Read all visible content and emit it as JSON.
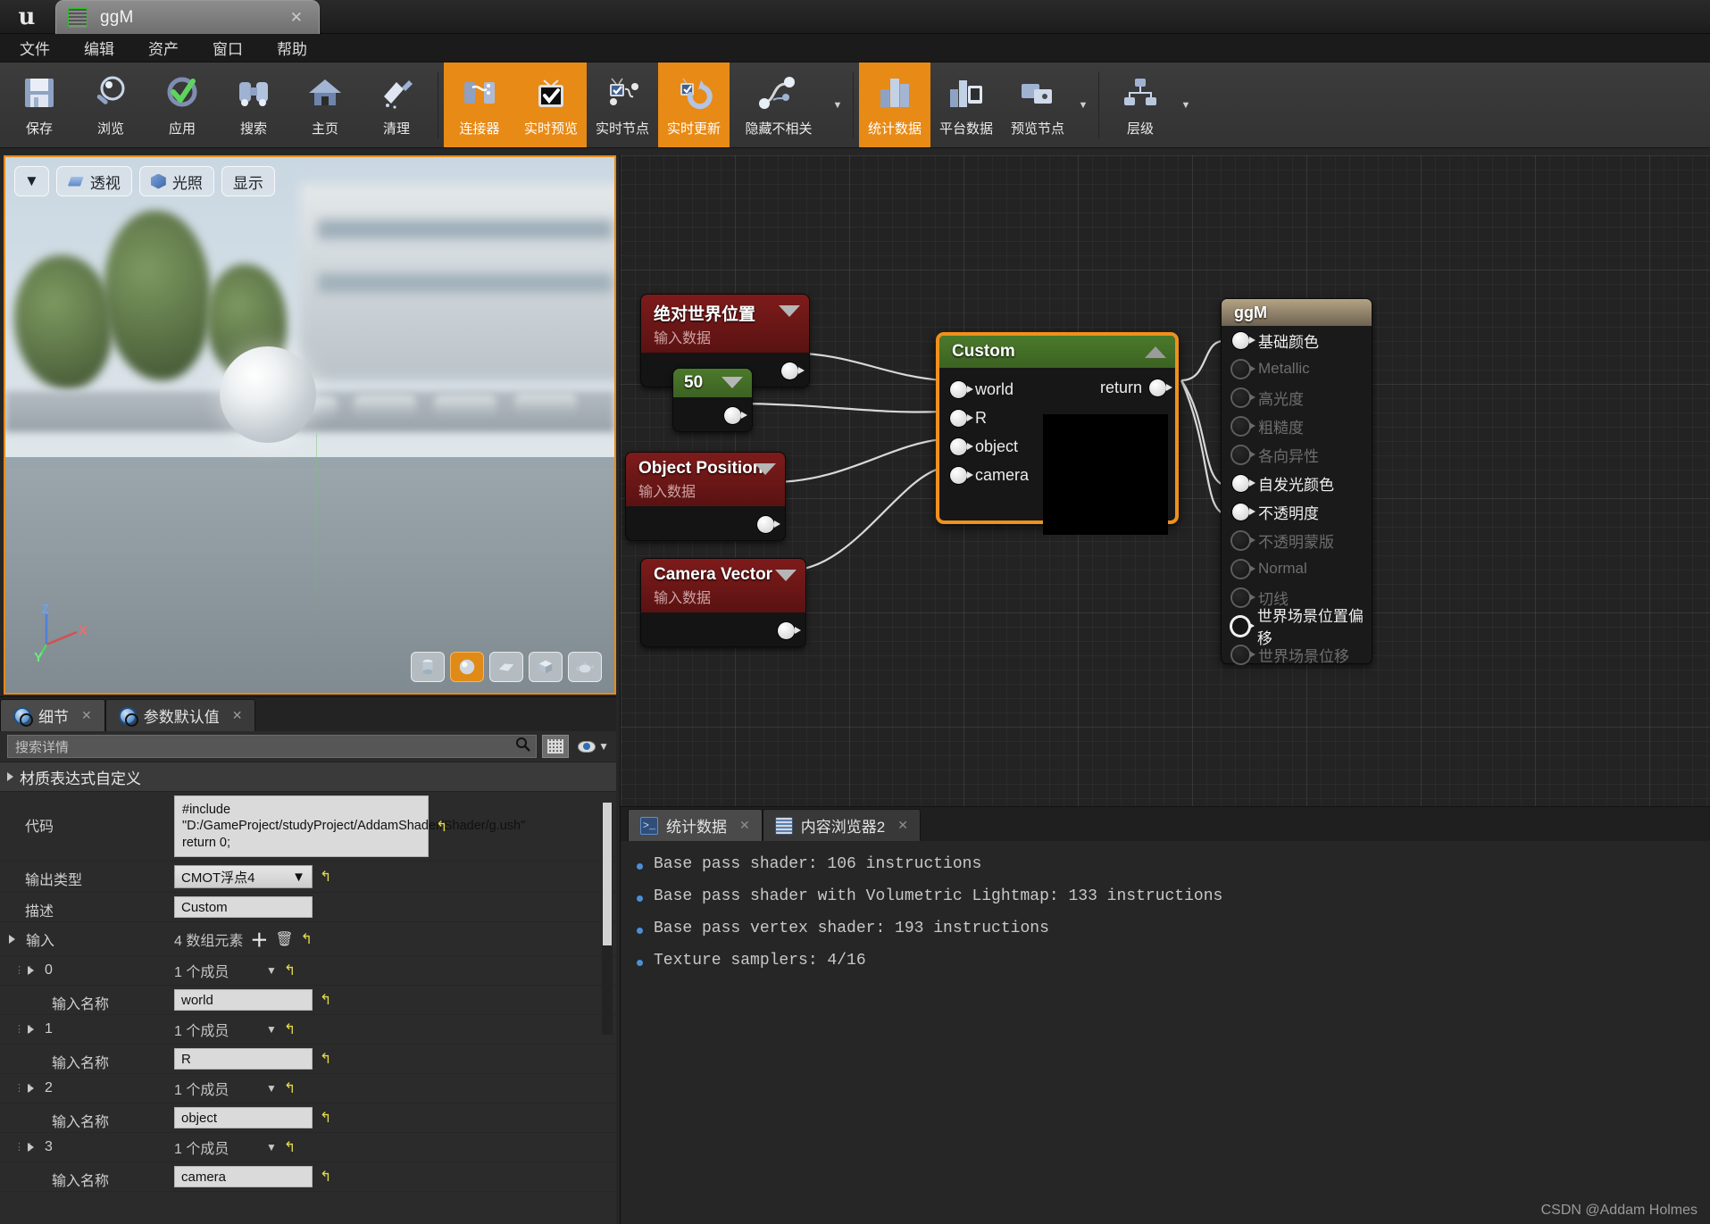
{
  "titlebar": {
    "asset_tab_label": "ggM",
    "close_glyph": "✕"
  },
  "menubar": {
    "items": [
      "文件",
      "编辑",
      "资产",
      "窗口",
      "帮助"
    ]
  },
  "toolbar": {
    "items": [
      {
        "label": "保存",
        "icon": "save-icon",
        "active": false
      },
      {
        "label": "浏览",
        "icon": "browse-icon",
        "active": false
      },
      {
        "label": "应用",
        "icon": "apply-check-icon",
        "active": false
      },
      {
        "label": "搜索",
        "icon": "search-binoculars-icon",
        "active": false
      },
      {
        "label": "主页",
        "icon": "home-icon",
        "active": false
      },
      {
        "label": "清理",
        "icon": "clean-icon",
        "active": false
      },
      {
        "label": "连接器",
        "icon": "connectors-icon",
        "active": true
      },
      {
        "label": "实时预览",
        "icon": "live-preview-icon",
        "active": true
      },
      {
        "label": "实时节点",
        "icon": "live-nodes-icon",
        "active": false
      },
      {
        "label": "实时更新",
        "icon": "live-update-icon",
        "active": true
      },
      {
        "label": "隐藏不相关",
        "icon": "hide-unrelated-icon",
        "active": false
      },
      {
        "label": "统计数据",
        "icon": "stats-bars-icon",
        "active": true
      },
      {
        "label": "平台数据",
        "icon": "platform-stats-icon",
        "active": false
      },
      {
        "label": "预览节点",
        "icon": "preview-node-icon",
        "active": false
      },
      {
        "label": "层级",
        "icon": "hierarchy-icon",
        "active": false
      }
    ]
  },
  "viewport": {
    "dropdown_glyph": "▼",
    "perspective_label": "透视",
    "lighting_label": "光照",
    "show_label": "显示",
    "axis": {
      "x": "X",
      "y": "Y",
      "z": "Z"
    },
    "shapes": [
      {
        "name": "cylinder-preview",
        "selected": false
      },
      {
        "name": "sphere-preview",
        "selected": true
      },
      {
        "name": "plane-preview",
        "selected": false
      },
      {
        "name": "cube-preview",
        "selected": false
      },
      {
        "name": "teapot-preview",
        "selected": false
      }
    ]
  },
  "details": {
    "tabs": [
      {
        "label": "细节",
        "selected": true,
        "close": "✕"
      },
      {
        "label": "参数默认值",
        "selected": false,
        "close": "✕"
      }
    ],
    "search_placeholder": "搜索详情",
    "search_value": "",
    "category": "材质表达式自定义",
    "rows": [
      {
        "name": "代码",
        "type": "code",
        "value": "#include \"D:/GameProject/studyProject/AddamShader/Shader/g.ush\"\nreturn 0;"
      },
      {
        "name": "输出类型",
        "type": "select",
        "value": "CMOT浮点4"
      },
      {
        "name": "描述",
        "type": "text",
        "value": "Custom"
      },
      {
        "name": "输入",
        "type": "array_header",
        "value": "4 数组元素"
      },
      {
        "name": "0",
        "type": "index",
        "value": "1 个成员"
      },
      {
        "name": "输入名称",
        "type": "text",
        "value": "world"
      },
      {
        "name": "1",
        "type": "index",
        "value": "1 个成员"
      },
      {
        "name": "输入名称",
        "type": "text",
        "value": "R"
      },
      {
        "name": "2",
        "type": "index",
        "value": "1 个成员"
      },
      {
        "name": "输入名称",
        "type": "text",
        "value": "object"
      },
      {
        "name": "3",
        "type": "index",
        "value": "1 个成员"
      },
      {
        "name": "输入名称",
        "type": "text",
        "value": "camera"
      }
    ]
  },
  "graph": {
    "nodes": [
      {
        "id": "abs-world-pos",
        "title": "绝对世界位置",
        "subtitle": "输入数据",
        "header": "red",
        "caret": "down"
      },
      {
        "id": "const-50",
        "title": "50",
        "subtitle": "",
        "header": "green",
        "caret": "down"
      },
      {
        "id": "object-position",
        "title": "Object Position",
        "subtitle": "输入数据",
        "header": "red",
        "caret": "down"
      },
      {
        "id": "camera-vector",
        "title": "Camera Vector",
        "subtitle": "输入数据",
        "header": "red",
        "caret": "down"
      }
    ],
    "custom_node": {
      "title": "Custom",
      "caret": "up",
      "inputs": [
        "world",
        "R",
        "object",
        "camera"
      ],
      "output": "return",
      "selected": true,
      "accent": "#f0901d"
    },
    "output_node": {
      "title": "ggM",
      "pins": [
        {
          "label": "基础颜色",
          "connected": true
        },
        {
          "label": "Metallic",
          "connected": false
        },
        {
          "label": "高光度",
          "connected": false
        },
        {
          "label": "粗糙度",
          "connected": false
        },
        {
          "label": "各向异性",
          "connected": false
        },
        {
          "label": "自发光颜色",
          "connected": true
        },
        {
          "label": "不透明度",
          "connected": true
        },
        {
          "label": "不透明蒙版",
          "connected": false
        },
        {
          "label": "Normal",
          "connected": false
        },
        {
          "label": "切线",
          "connected": false
        },
        {
          "label": "世界场景位置偏移",
          "connected": false,
          "ring": true
        },
        {
          "label": "世界场景位移",
          "connected": false
        }
      ]
    }
  },
  "stats_panel": {
    "tabs": [
      {
        "label": "统计数据",
        "selected": true,
        "close": "✕"
      },
      {
        "label": "内容浏览器2",
        "selected": false,
        "close": "✕"
      }
    ],
    "items": [
      "Base pass shader: 106 instructions",
      "Base pass shader with Volumetric Lightmap: 133 instructions",
      "Base pass vertex shader: 193 instructions",
      "Texture samplers: 4/16"
    ]
  },
  "watermark": "CSDN @Addam Holmes"
}
